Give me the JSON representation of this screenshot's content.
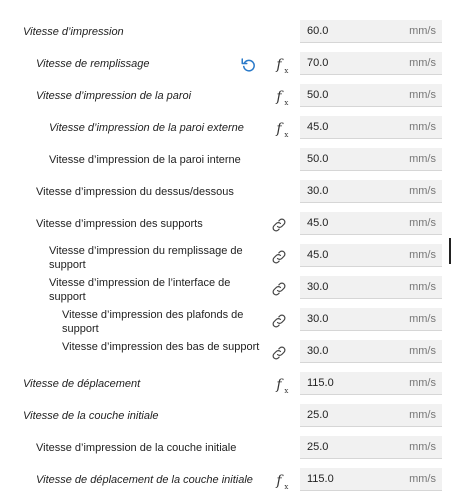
{
  "settings": [
    {
      "label": "Vitesse d’impression",
      "value": "60.0",
      "unit": "mm/s",
      "italic": true,
      "indent": 0,
      "icon": null,
      "reset": false,
      "wrap": false
    },
    {
      "label": "Vitesse de remplissage",
      "value": "70.0",
      "unit": "mm/s",
      "italic": true,
      "indent": 1,
      "icon": "function-icon",
      "reset": true,
      "wrap": false
    },
    {
      "label": "Vitesse d’impression de la paroi",
      "value": "50.0",
      "unit": "mm/s",
      "italic": true,
      "indent": 1,
      "icon": "function-icon",
      "reset": false,
      "wrap": false
    },
    {
      "label": "Vitesse d’impression de la paroi externe",
      "value": "45.0",
      "unit": "mm/s",
      "italic": true,
      "indent": 2,
      "icon": "function-icon",
      "reset": false,
      "wrap": false
    },
    {
      "label": "Vitesse d’impression de la paroi interne",
      "value": "50.0",
      "unit": "mm/s",
      "italic": false,
      "indent": 2,
      "icon": null,
      "reset": false,
      "wrap": false
    },
    {
      "label": "Vitesse d’impression du dessus/dessous",
      "value": "30.0",
      "unit": "mm/s",
      "italic": false,
      "indent": 1,
      "icon": null,
      "reset": false,
      "wrap": false
    },
    {
      "label": "Vitesse d’impression des supports",
      "value": "45.0",
      "unit": "mm/s",
      "italic": false,
      "indent": 1,
      "icon": "link-icon",
      "reset": false,
      "wrap": false
    },
    {
      "label": "Vitesse d’impression du remplissage de support",
      "value": "45.0",
      "unit": "mm/s",
      "italic": false,
      "indent": 2,
      "icon": "link-icon",
      "reset": false,
      "wrap": true
    },
    {
      "label": "Vitesse d’impression de l’interface de support",
      "value": "30.0",
      "unit": "mm/s",
      "italic": false,
      "indent": 2,
      "icon": "link-icon",
      "reset": false,
      "wrap": true
    },
    {
      "label": "Vitesse d’impression des plafonds de support",
      "value": "30.0",
      "unit": "mm/s",
      "italic": false,
      "indent": 3,
      "icon": "link-icon",
      "reset": false,
      "wrap": true
    },
    {
      "label": "Vitesse d’impression des bas de support",
      "value": "30.0",
      "unit": "mm/s",
      "italic": false,
      "indent": 3,
      "icon": "link-icon",
      "reset": false,
      "wrap": true
    },
    {
      "label": "Vitesse de déplacement",
      "value": "115.0",
      "unit": "mm/s",
      "italic": true,
      "indent": 0,
      "icon": "function-icon",
      "reset": false,
      "wrap": false
    },
    {
      "label": "Vitesse de la couche initiale",
      "value": "25.0",
      "unit": "mm/s",
      "italic": true,
      "indent": 0,
      "icon": null,
      "reset": false,
      "wrap": false
    },
    {
      "label": "Vitesse d’impression de la couche initiale",
      "value": "25.0",
      "unit": "mm/s",
      "italic": false,
      "indent": 1,
      "icon": null,
      "reset": false,
      "wrap": false
    },
    {
      "label": "Vitesse de déplacement de la couche initiale",
      "value": "115.0",
      "unit": "mm/s",
      "italic": true,
      "indent": 1,
      "icon": "function-icon",
      "reset": false,
      "wrap": false
    }
  ],
  "colors": {
    "accent": "#2979c9",
    "field_bg": "#f1f1f1",
    "unit_text": "#777777"
  }
}
